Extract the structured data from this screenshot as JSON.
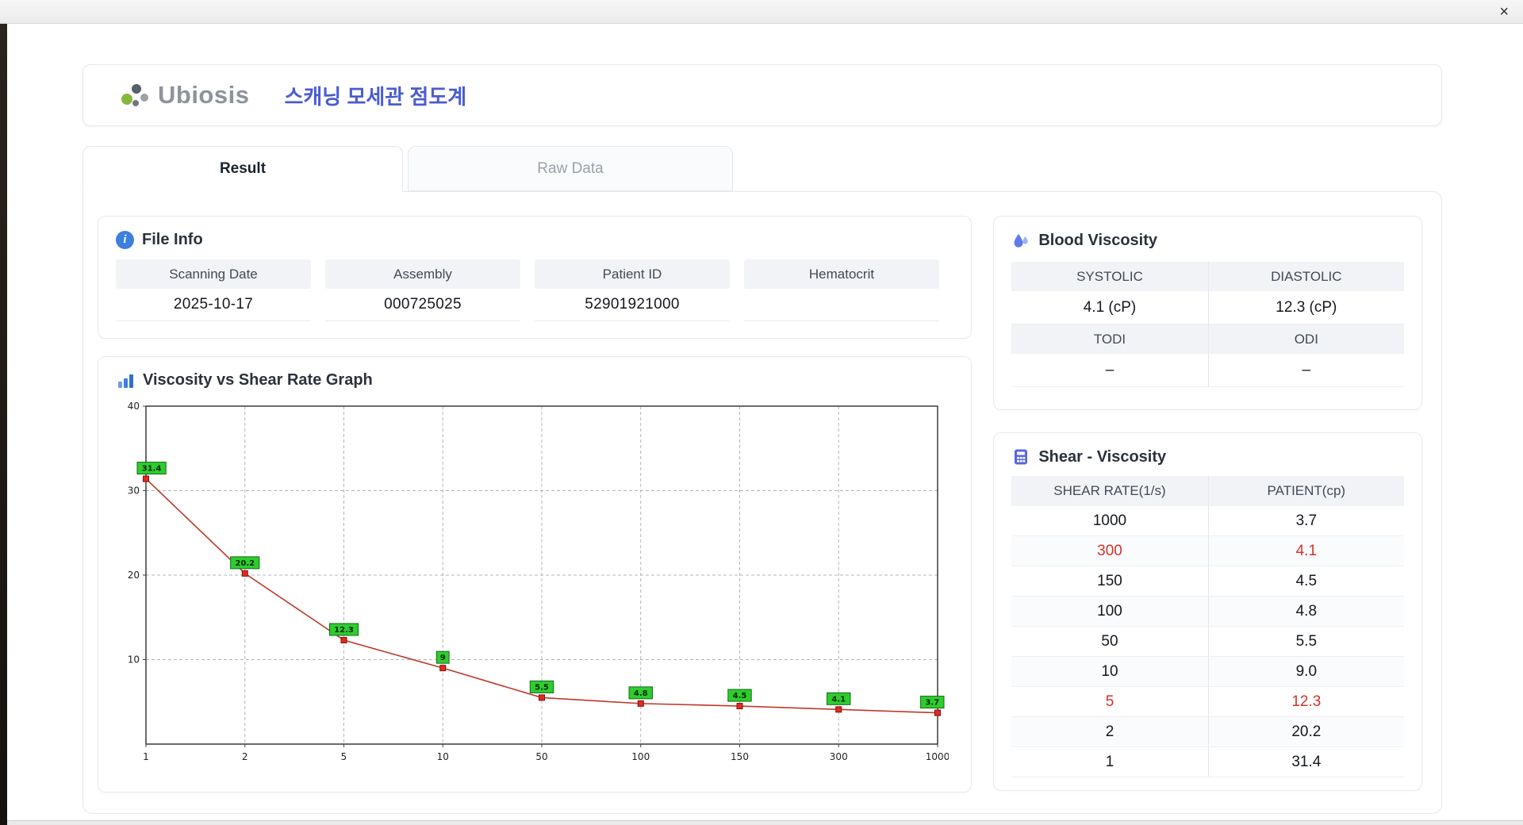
{
  "window": {
    "close_icon": "×"
  },
  "header": {
    "brand": "Ubiosis",
    "title": "스캐닝 모세관 점도계"
  },
  "tabs": [
    {
      "label": "Result",
      "active": true
    },
    {
      "label": "Raw Data",
      "active": false
    }
  ],
  "file_info": {
    "title": "File Info",
    "fields": [
      {
        "label": "Scanning Date",
        "value": "2025-10-17"
      },
      {
        "label": "Assembly",
        "value": "000725025"
      },
      {
        "label": "Patient ID",
        "value": "52901921000"
      },
      {
        "label": "Hematocrit",
        "value": ""
      }
    ]
  },
  "graph": {
    "title": "Viscosity vs Shear Rate Graph"
  },
  "chart_data": {
    "type": "line",
    "title": "Viscosity vs Shear Rate Graph",
    "xlabel": "",
    "ylabel": "",
    "x_categories": [
      "1",
      "2",
      "5",
      "10",
      "50",
      "100",
      "150",
      "300",
      "1000"
    ],
    "values": [
      31.4,
      20.2,
      12.3,
      9,
      5.5,
      4.8,
      4.5,
      4.1,
      3.7
    ],
    "point_labels": [
      "31.4",
      "20.2",
      "12.3",
      "9",
      "5.5",
      "4.8",
      "4.5",
      "4.1",
      "3.7"
    ],
    "ylim": [
      0,
      40
    ],
    "yticks": [
      10,
      20,
      30,
      40
    ],
    "grid": "dashed",
    "legend": "none",
    "line_color": "#c0392b",
    "marker_color": "#e02b20",
    "label_bg": "#2fcc2f"
  },
  "blood_viscosity": {
    "title": "Blood Viscosity",
    "rows": [
      [
        {
          "label": "SYSTOLIC",
          "value": "4.1 (cP)"
        },
        {
          "label": "DIASTOLIC",
          "value": "12.3 (cP)"
        }
      ],
      [
        {
          "label": "TODI",
          "value": "–"
        },
        {
          "label": "ODI",
          "value": "–"
        }
      ]
    ]
  },
  "shear_viscosity": {
    "title": "Shear - Viscosity",
    "columns": [
      "SHEAR RATE(1/s)",
      "PATIENT(cp)"
    ],
    "rows": [
      {
        "shear": "1000",
        "patient": "3.7",
        "highlight": false
      },
      {
        "shear": "300",
        "patient": "4.1",
        "highlight": true
      },
      {
        "shear": "150",
        "patient": "4.5",
        "highlight": false
      },
      {
        "shear": "100",
        "patient": "4.8",
        "highlight": false
      },
      {
        "shear": "50",
        "patient": "5.5",
        "highlight": false
      },
      {
        "shear": "10",
        "patient": "9.0",
        "highlight": false
      },
      {
        "shear": "5",
        "patient": "12.3",
        "highlight": true
      },
      {
        "shear": "2",
        "patient": "20.2",
        "highlight": false
      },
      {
        "shear": "1",
        "patient": "31.4",
        "highlight": false
      }
    ]
  },
  "colors": {
    "accent": "#4a5cd0",
    "highlight_red": "#d0342c",
    "header_gray": "#f1f3f6"
  }
}
